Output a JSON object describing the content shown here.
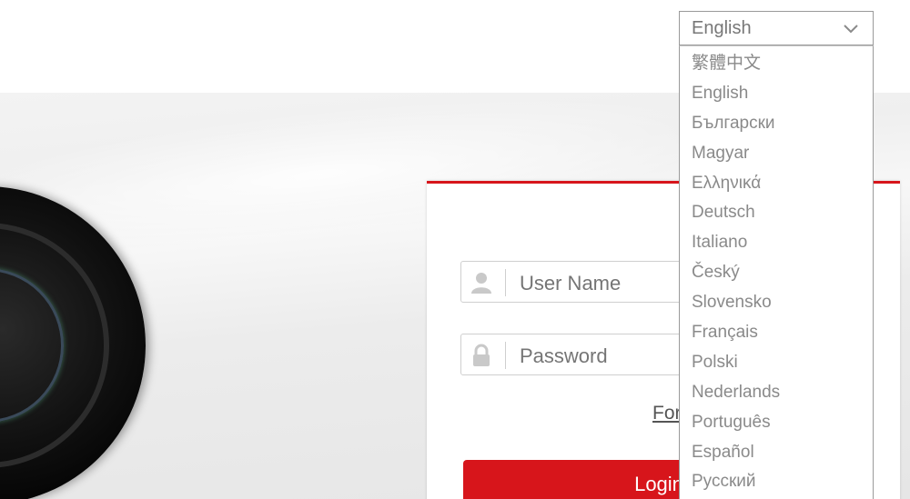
{
  "language_select": {
    "selected": "English",
    "options": [
      "繁體中文",
      "English",
      "Български",
      "Magyar",
      "Ελληνικά",
      "Deutsch",
      "Italiano",
      "Český",
      "Slovensko",
      "Français",
      "Polski",
      "Nederlands",
      "Português",
      "Español",
      "Русский"
    ]
  },
  "login": {
    "username_placeholder": "User Name",
    "password_placeholder": "Password",
    "forgot_link": "For",
    "login_button": "Login",
    "accent_color": "#d7151b"
  },
  "icons": {
    "user": "user-icon",
    "lock": "lock-icon",
    "chevron": "chevron-down-icon"
  }
}
